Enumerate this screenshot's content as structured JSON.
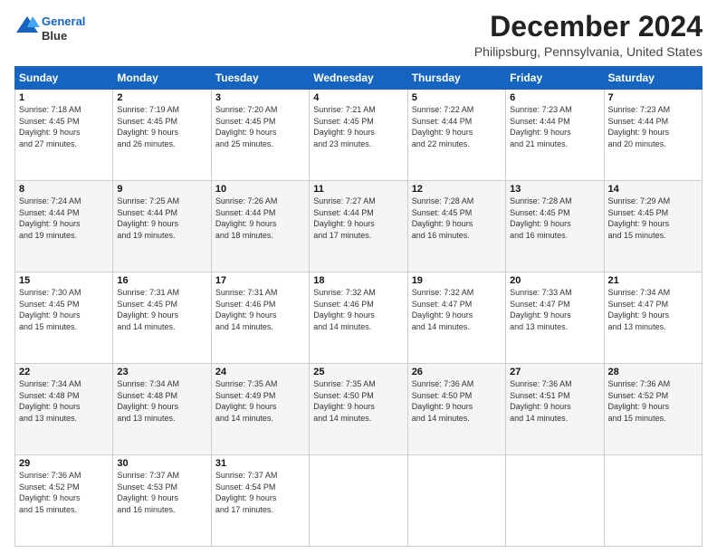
{
  "header": {
    "logo_line1": "General",
    "logo_line2": "Blue",
    "month": "December 2024",
    "location": "Philipsburg, Pennsylvania, United States"
  },
  "days_of_week": [
    "Sunday",
    "Monday",
    "Tuesday",
    "Wednesday",
    "Thursday",
    "Friday",
    "Saturday"
  ],
  "weeks": [
    [
      {
        "day": "1",
        "lines": [
          "Sunrise: 7:18 AM",
          "Sunset: 4:45 PM",
          "Daylight: 9 hours",
          "and 27 minutes."
        ]
      },
      {
        "day": "2",
        "lines": [
          "Sunrise: 7:19 AM",
          "Sunset: 4:45 PM",
          "Daylight: 9 hours",
          "and 26 minutes."
        ]
      },
      {
        "day": "3",
        "lines": [
          "Sunrise: 7:20 AM",
          "Sunset: 4:45 PM",
          "Daylight: 9 hours",
          "and 25 minutes."
        ]
      },
      {
        "day": "4",
        "lines": [
          "Sunrise: 7:21 AM",
          "Sunset: 4:45 PM",
          "Daylight: 9 hours",
          "and 23 minutes."
        ]
      },
      {
        "day": "5",
        "lines": [
          "Sunrise: 7:22 AM",
          "Sunset: 4:44 PM",
          "Daylight: 9 hours",
          "and 22 minutes."
        ]
      },
      {
        "day": "6",
        "lines": [
          "Sunrise: 7:23 AM",
          "Sunset: 4:44 PM",
          "Daylight: 9 hours",
          "and 21 minutes."
        ]
      },
      {
        "day": "7",
        "lines": [
          "Sunrise: 7:23 AM",
          "Sunset: 4:44 PM",
          "Daylight: 9 hours",
          "and 20 minutes."
        ]
      }
    ],
    [
      {
        "day": "8",
        "lines": [
          "Sunrise: 7:24 AM",
          "Sunset: 4:44 PM",
          "Daylight: 9 hours",
          "and 19 minutes."
        ]
      },
      {
        "day": "9",
        "lines": [
          "Sunrise: 7:25 AM",
          "Sunset: 4:44 PM",
          "Daylight: 9 hours",
          "and 19 minutes."
        ]
      },
      {
        "day": "10",
        "lines": [
          "Sunrise: 7:26 AM",
          "Sunset: 4:44 PM",
          "Daylight: 9 hours",
          "and 18 minutes."
        ]
      },
      {
        "day": "11",
        "lines": [
          "Sunrise: 7:27 AM",
          "Sunset: 4:44 PM",
          "Daylight: 9 hours",
          "and 17 minutes."
        ]
      },
      {
        "day": "12",
        "lines": [
          "Sunrise: 7:28 AM",
          "Sunset: 4:45 PM",
          "Daylight: 9 hours",
          "and 16 minutes."
        ]
      },
      {
        "day": "13",
        "lines": [
          "Sunrise: 7:28 AM",
          "Sunset: 4:45 PM",
          "Daylight: 9 hours",
          "and 16 minutes."
        ]
      },
      {
        "day": "14",
        "lines": [
          "Sunrise: 7:29 AM",
          "Sunset: 4:45 PM",
          "Daylight: 9 hours",
          "and 15 minutes."
        ]
      }
    ],
    [
      {
        "day": "15",
        "lines": [
          "Sunrise: 7:30 AM",
          "Sunset: 4:45 PM",
          "Daylight: 9 hours",
          "and 15 minutes."
        ]
      },
      {
        "day": "16",
        "lines": [
          "Sunrise: 7:31 AM",
          "Sunset: 4:45 PM",
          "Daylight: 9 hours",
          "and 14 minutes."
        ]
      },
      {
        "day": "17",
        "lines": [
          "Sunrise: 7:31 AM",
          "Sunset: 4:46 PM",
          "Daylight: 9 hours",
          "and 14 minutes."
        ]
      },
      {
        "day": "18",
        "lines": [
          "Sunrise: 7:32 AM",
          "Sunset: 4:46 PM",
          "Daylight: 9 hours",
          "and 14 minutes."
        ]
      },
      {
        "day": "19",
        "lines": [
          "Sunrise: 7:32 AM",
          "Sunset: 4:47 PM",
          "Daylight: 9 hours",
          "and 14 minutes."
        ]
      },
      {
        "day": "20",
        "lines": [
          "Sunrise: 7:33 AM",
          "Sunset: 4:47 PM",
          "Daylight: 9 hours",
          "and 13 minutes."
        ]
      },
      {
        "day": "21",
        "lines": [
          "Sunrise: 7:34 AM",
          "Sunset: 4:47 PM",
          "Daylight: 9 hours",
          "and 13 minutes."
        ]
      }
    ],
    [
      {
        "day": "22",
        "lines": [
          "Sunrise: 7:34 AM",
          "Sunset: 4:48 PM",
          "Daylight: 9 hours",
          "and 13 minutes."
        ]
      },
      {
        "day": "23",
        "lines": [
          "Sunrise: 7:34 AM",
          "Sunset: 4:48 PM",
          "Daylight: 9 hours",
          "and 13 minutes."
        ]
      },
      {
        "day": "24",
        "lines": [
          "Sunrise: 7:35 AM",
          "Sunset: 4:49 PM",
          "Daylight: 9 hours",
          "and 14 minutes."
        ]
      },
      {
        "day": "25",
        "lines": [
          "Sunrise: 7:35 AM",
          "Sunset: 4:50 PM",
          "Daylight: 9 hours",
          "and 14 minutes."
        ]
      },
      {
        "day": "26",
        "lines": [
          "Sunrise: 7:36 AM",
          "Sunset: 4:50 PM",
          "Daylight: 9 hours",
          "and 14 minutes."
        ]
      },
      {
        "day": "27",
        "lines": [
          "Sunrise: 7:36 AM",
          "Sunset: 4:51 PM",
          "Daylight: 9 hours",
          "and 14 minutes."
        ]
      },
      {
        "day": "28",
        "lines": [
          "Sunrise: 7:36 AM",
          "Sunset: 4:52 PM",
          "Daylight: 9 hours",
          "and 15 minutes."
        ]
      }
    ],
    [
      {
        "day": "29",
        "lines": [
          "Sunrise: 7:36 AM",
          "Sunset: 4:52 PM",
          "Daylight: 9 hours",
          "and 15 minutes."
        ]
      },
      {
        "day": "30",
        "lines": [
          "Sunrise: 7:37 AM",
          "Sunset: 4:53 PM",
          "Daylight: 9 hours",
          "and 16 minutes."
        ]
      },
      {
        "day": "31",
        "lines": [
          "Sunrise: 7:37 AM",
          "Sunset: 4:54 PM",
          "Daylight: 9 hours",
          "and 17 minutes."
        ]
      },
      null,
      null,
      null,
      null
    ]
  ]
}
